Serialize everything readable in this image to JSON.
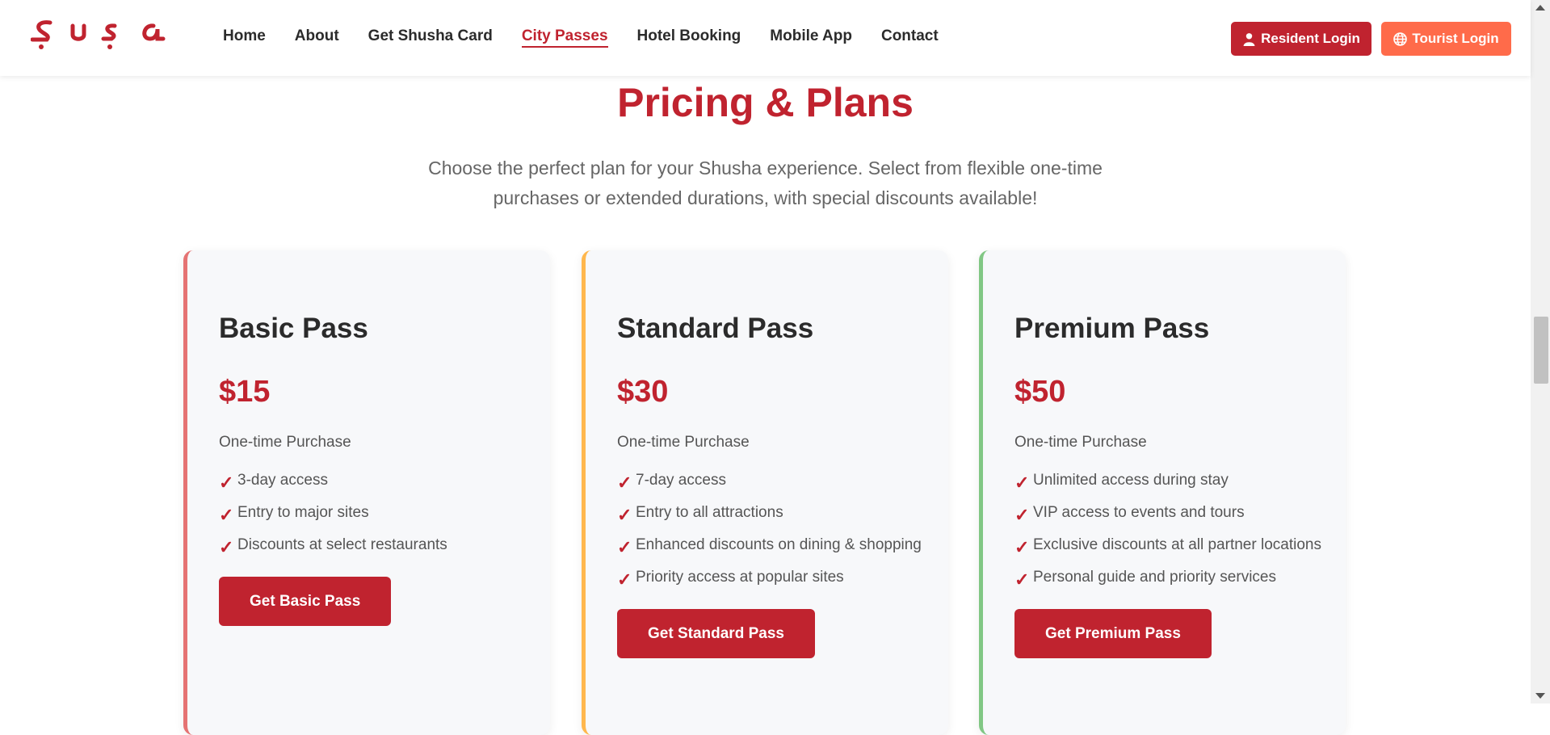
{
  "header": {
    "logo_text": "Şuşa",
    "nav": [
      {
        "label": "Home"
      },
      {
        "label": "About"
      },
      {
        "label": "Get Shusha Card"
      },
      {
        "label": "City Passes",
        "active": true
      },
      {
        "label": "Hotel Booking"
      },
      {
        "label": "Mobile App"
      },
      {
        "label": "Contact"
      }
    ],
    "resident_login": "Resident Login",
    "tourist_login": "Tourist Login"
  },
  "hero": {
    "title": "Pricing & Plans",
    "subtitle": "Choose the perfect plan for your Shusha experience. Select from flexible one-time purchases or extended durations, with special discounts available!"
  },
  "plans": [
    {
      "name": "Basic Pass",
      "price": "$15",
      "type": "One-time Purchase",
      "features": [
        "3-day access",
        "Entry to major sites",
        "Discounts at select restaurants"
      ],
      "cta": "Get Basic Pass",
      "accent": "#e57373"
    },
    {
      "name": "Standard Pass",
      "price": "$30",
      "type": "One-time Purchase",
      "features": [
        "7-day access",
        "Entry to all attractions",
        "Enhanced discounts on dining & shopping",
        "Priority access at popular sites"
      ],
      "cta": "Get Standard Pass",
      "accent": "#ffb74d"
    },
    {
      "name": "Premium Pass",
      "price": "$50",
      "type": "One-time Purchase",
      "features": [
        "Unlimited access during stay",
        "VIP access to events and tours",
        "Exclusive discounts at all partner locations",
        "Personal guide and priority services"
      ],
      "cta": "Get Premium Pass",
      "accent": "#81c784"
    }
  ],
  "colors": {
    "brand": "#c0232f",
    "tourist": "#ff6b4a",
    "check_icon": "check-icon"
  }
}
